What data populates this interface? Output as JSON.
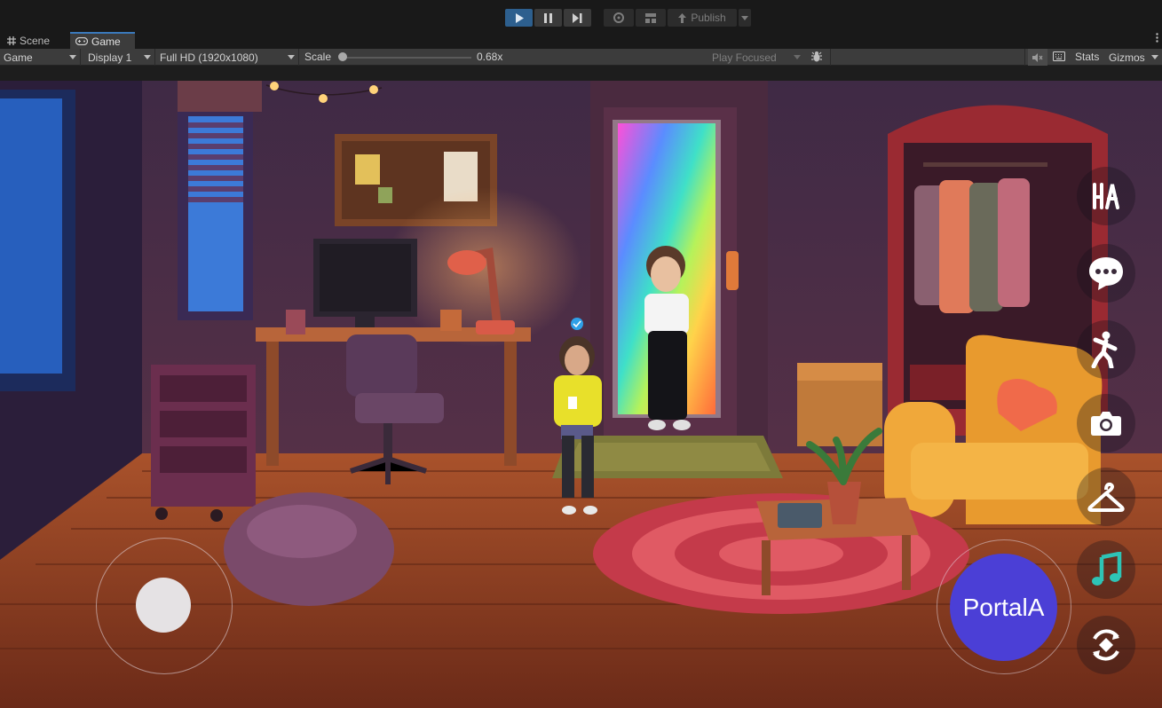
{
  "toolbar": {
    "publish_label": "Publish"
  },
  "tabs": [
    {
      "label": "Scene",
      "icon": "grid-icon",
      "active": false
    },
    {
      "label": "Game",
      "icon": "gamepad-icon",
      "active": true
    }
  ],
  "game_toolbar": {
    "view_mode": "Game",
    "display": "Display 1",
    "resolution": "Full HD (1920x1080)",
    "scale_label": "Scale",
    "scale_value": "0.68x",
    "play_mode": "Play Focused",
    "stats_label": "Stats",
    "gizmos_label": "Gizmos"
  },
  "hud": {
    "action_button_label": "PortalA",
    "side_buttons": [
      "text-style-icon",
      "chat-bubble-icon",
      "dance-emote-icon",
      "camera-icon",
      "clothes-hanger-icon",
      "music-note-icon",
      "portal-spin-icon"
    ]
  },
  "colors": {
    "accent_blue": "#2d5f8e",
    "action_button": "#4b3fd6",
    "music_icon": "#2ec4b6"
  }
}
